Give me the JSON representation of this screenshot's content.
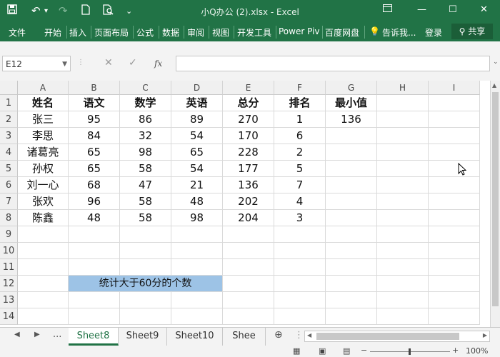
{
  "window": {
    "title": "小Q办公 (2).xlsx - Excel",
    "quick_access": [
      "save-icon",
      "undo-icon",
      "redo-icon",
      "new-icon",
      "print-preview-icon",
      "customize-icon"
    ],
    "controls": [
      "ribbon-display-icon",
      "minimize-icon",
      "restore-icon",
      "close-icon"
    ]
  },
  "ribbon": {
    "tabs": [
      "文件",
      "开始",
      "插入",
      "页面布局",
      "公式",
      "数据",
      "审阅",
      "视图",
      "开发工具",
      "Power Piv",
      "百度网盘"
    ],
    "tell_me": "告诉我...",
    "login": "登录",
    "share": "共享"
  },
  "formula_bar": {
    "name_box": "E12",
    "cancel": "✕",
    "enter": "✓",
    "fx": "fx",
    "content": ""
  },
  "sheet": {
    "columns": [
      "A",
      "B",
      "C",
      "D",
      "E",
      "F",
      "G",
      "H",
      "I"
    ],
    "rows": [
      "1",
      "2",
      "3",
      "4",
      "5",
      "6",
      "7",
      "8",
      "9",
      "10",
      "11",
      "12",
      "13",
      "14"
    ],
    "header": [
      "姓名",
      "语文",
      "数学",
      "英语",
      "总分",
      "排名",
      "最小值"
    ],
    "data": [
      [
        "张三",
        "95",
        "86",
        "89",
        "270",
        "1",
        "136"
      ],
      [
        "李思",
        "84",
        "32",
        "54",
        "170",
        "6",
        ""
      ],
      [
        "诸葛亮",
        "65",
        "98",
        "65",
        "228",
        "2",
        ""
      ],
      [
        "孙权",
        "65",
        "58",
        "54",
        "177",
        "5",
        ""
      ],
      [
        "刘一心",
        "68",
        "47",
        "21",
        "136",
        "7",
        ""
      ],
      [
        "张欢",
        "96",
        "58",
        "48",
        "202",
        "4",
        ""
      ],
      [
        "陈鑫",
        "48",
        "58",
        "98",
        "204",
        "3",
        ""
      ]
    ],
    "merged_note": "统计大于60分的个数",
    "highlight_color": "#9dc3e6"
  },
  "sheet_tabs": {
    "ellipsis": "...",
    "tabs": [
      "Sheet8",
      "Sheet9",
      "Sheet10",
      "Shee"
    ],
    "active": "Sheet8"
  },
  "status": {
    "zoom": "100%",
    "accent": "#217346"
  }
}
